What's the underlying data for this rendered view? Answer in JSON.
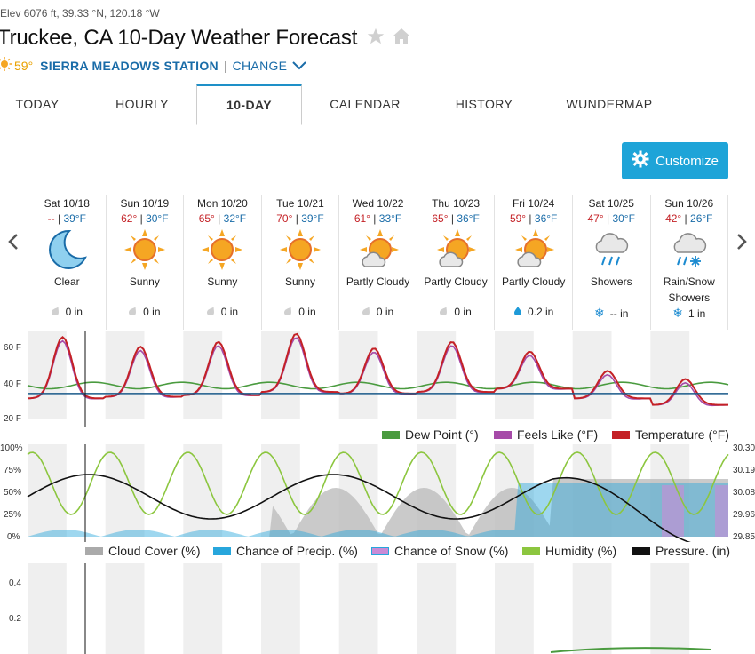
{
  "header": {
    "elevation": "Elev 6076 ft, 39.33 °N, 120.18 °W",
    "title": "Truckee, CA 10-Day Weather Forecast",
    "current_temp": "59°",
    "station": "SIERRA MEADOWS STATION",
    "separator": "|",
    "change": "CHANGE"
  },
  "tabs": [
    "TODAY",
    "HOURLY",
    "10-DAY",
    "CALENDAR",
    "HISTORY",
    "WUNDERMAP"
  ],
  "active_tab": "10-DAY",
  "customize_label": "Customize",
  "days": [
    {
      "name": "Sat 10/18",
      "hi": "--",
      "lo": "39°F",
      "cond": "Clear",
      "icon": "moon-clear-icon",
      "precip": "0 in"
    },
    {
      "name": "Sun 10/19",
      "hi": "62°",
      "lo": "30°F",
      "cond": "Sunny",
      "icon": "sun-icon",
      "precip": "0 in"
    },
    {
      "name": "Mon 10/20",
      "hi": "65°",
      "lo": "32°F",
      "cond": "Sunny",
      "icon": "sun-icon",
      "precip": "0 in"
    },
    {
      "name": "Tue 10/21",
      "hi": "70°",
      "lo": "39°F",
      "cond": "Sunny",
      "icon": "sun-icon",
      "precip": "0 in"
    },
    {
      "name": "Wed 10/22",
      "hi": "61°",
      "lo": "33°F",
      "cond": "Partly Cloudy",
      "icon": "partly-cloudy-icon",
      "precip": "0 in"
    },
    {
      "name": "Thu 10/23",
      "hi": "65°",
      "lo": "36°F",
      "cond": "Partly Cloudy",
      "icon": "partly-cloudy-icon",
      "precip": "0 in"
    },
    {
      "name": "Fri 10/24",
      "hi": "59°",
      "lo": "36°F",
      "cond": "Partly Cloudy",
      "icon": "partly-cloudy-icon",
      "precip": "0.2 in"
    },
    {
      "name": "Sat 10/25",
      "hi": "47°",
      "lo": "30°F",
      "cond": "Showers",
      "icon": "rain-showers-icon",
      "precip": "-- in"
    },
    {
      "name": "Sun 10/26",
      "hi": "42°",
      "lo": "26°F",
      "cond": "Rain/Snow Showers",
      "icon": "rain-snow-icon",
      "precip": "1 in"
    }
  ],
  "temp_chart": {
    "y_ticks": [
      "60 F",
      "40 F",
      "20 F"
    ],
    "legend": [
      "Dew Point (°)",
      "Feels Like (°F)",
      "Temperature (°F)"
    ],
    "colors": {
      "dew": "#4a9b3f",
      "feels": "#a64aa8",
      "temp": "#c42126",
      "avg": "#1a5a8a"
    }
  },
  "precip_chart": {
    "y_ticks_left": [
      "100%",
      "75%",
      "50%",
      "25%",
      "0%"
    ],
    "y_ticks_right": [
      "30.30",
      "30.19",
      "30.08",
      "29.96",
      "29.85"
    ],
    "legend": [
      "Cloud Cover (%)",
      "Chance of Precip. (%)",
      "Chance of Snow (%)",
      "Humidity (%)",
      "Pressure. (in)"
    ],
    "colors": {
      "cloud": "#aaaaaa",
      "precip": "#27a6dc",
      "snow": "#c98bd6",
      "humidity": "#8cc63f",
      "pressure": "#111111"
    }
  },
  "amount_chart": {
    "y_ticks": [
      "0.4",
      "0.2"
    ]
  }
}
